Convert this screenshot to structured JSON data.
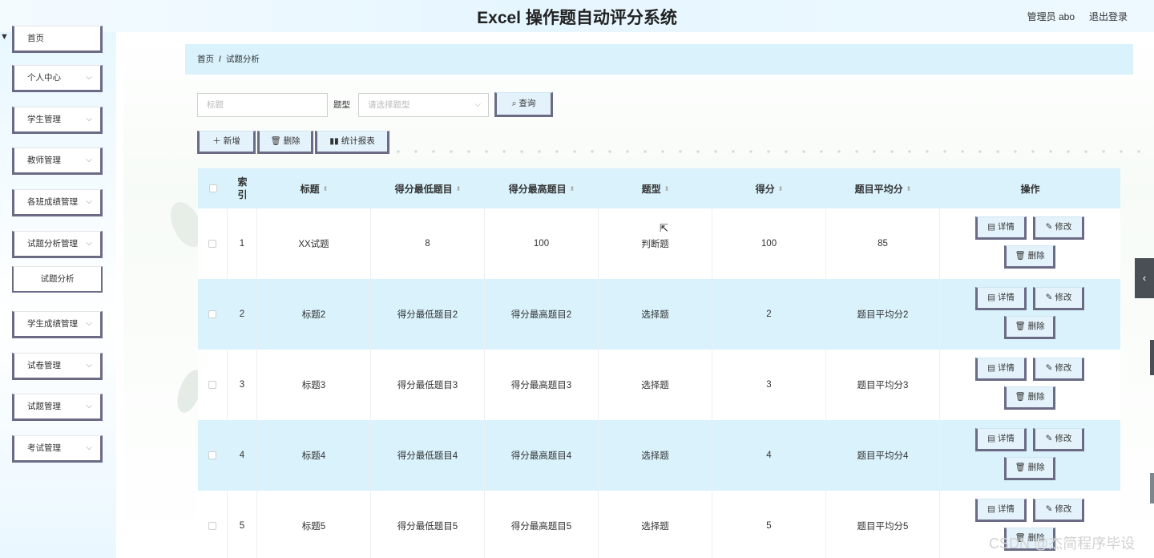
{
  "header": {
    "title": "Excel 操作题自动评分系统",
    "user": "管理员 abo",
    "logout": "退出登录"
  },
  "sidebar": {
    "items": [
      {
        "label": "首页"
      },
      {
        "label": "个人中心"
      },
      {
        "label": "学生管理"
      },
      {
        "label": "教师管理"
      },
      {
        "label": "各班成绩管理"
      },
      {
        "label": "试题分析管理"
      },
      {
        "label": "学生成绩管理"
      },
      {
        "label": "试卷管理"
      },
      {
        "label": "试题管理"
      },
      {
        "label": "考试管理"
      }
    ],
    "submenu": "试题分析"
  },
  "breadcrumb": {
    "home": "首页",
    "sep": "/",
    "current": "试题分析"
  },
  "search": {
    "title_placeholder": "标题",
    "type_label": "题型",
    "type_placeholder": "请选择题型",
    "query": "查询"
  },
  "toolbar": {
    "add": "新增",
    "delete": "删除",
    "report": "统计报表"
  },
  "table": {
    "headers": [
      "索引",
      "标题",
      "得分最低题目",
      "得分最高题目",
      "题型",
      "得分",
      "题目平均分",
      "操作"
    ],
    "rows": [
      {
        "index": "1",
        "title": "XX试题",
        "min": "8",
        "max": "100",
        "type": "判断题",
        "score": "100",
        "avg": "85"
      },
      {
        "index": "2",
        "title": "标题2",
        "min": "得分最低题目2",
        "max": "得分最高题目2",
        "type": "选择题",
        "score": "2",
        "avg": "题目平均分2"
      },
      {
        "index": "3",
        "title": "标题3",
        "min": "得分最低题目3",
        "max": "得分最高题目3",
        "type": "选择题",
        "score": "3",
        "avg": "题目平均分3"
      },
      {
        "index": "4",
        "title": "标题4",
        "min": "得分最低题目4",
        "max": "得分最高题目4",
        "type": "选择题",
        "score": "4",
        "avg": "题目平均分4"
      },
      {
        "index": "5",
        "title": "标题5",
        "min": "得分最低题目5",
        "max": "得分最高题目5",
        "type": "选择题",
        "score": "5",
        "avg": "题目平均分5"
      }
    ],
    "actions": {
      "detail": "详情",
      "edit": "修改",
      "delete": "删除"
    }
  },
  "watermark": "CSDN @杰简程序毕设",
  "colors": {
    "accent_border": "#6b6b86",
    "light_blue": "#d9f2fc",
    "button_bg": "#e4f3fb"
  }
}
